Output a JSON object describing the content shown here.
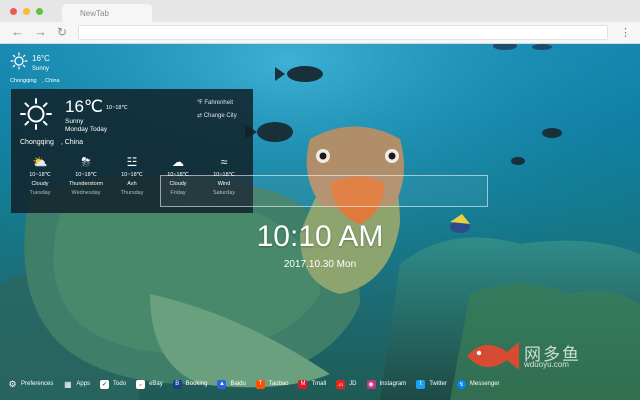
{
  "browser": {
    "tab_title": "NewTab",
    "back_icon": "back-arrow-icon",
    "forward_icon": "forward-arrow-icon",
    "reload_icon": "reload-icon",
    "menu_icon": "menu-icon",
    "url_value": ""
  },
  "weather_mini": {
    "temp": "16°C",
    "condition": "Sunny",
    "location": "Chongqing　, China"
  },
  "weather_panel": {
    "temp": "16℃",
    "range": "10~18℃",
    "condition": "Sunny",
    "day": "Monday Today",
    "location": "Chongqing　, China",
    "fahrenheit_label": "Fahrenheit",
    "change_city_label": "Change City",
    "forecast": [
      {
        "icon": "cloud-sun-icon",
        "range": "10~18℃",
        "cond": "Cloudy",
        "day": "Tuesday"
      },
      {
        "icon": "thunderstorm-icon",
        "range": "10~18℃",
        "cond": "Thunderstorm",
        "day": "Wednesday"
      },
      {
        "icon": "ash-icon",
        "range": "10~18℃",
        "cond": "Ash",
        "day": "Thursday"
      },
      {
        "icon": "cloud-icon",
        "range": "10~18℃",
        "cond": "Cloudy",
        "day": "Friday"
      },
      {
        "icon": "wind-icon",
        "range": "10~18℃",
        "cond": "Wind",
        "day": "Saturday"
      }
    ]
  },
  "search": {
    "placeholder": ""
  },
  "clock": {
    "time": "10:10 AM",
    "date": "2017.10.30 Mon"
  },
  "watermark": {
    "text": "网多鱼",
    "url": "wduoyu.com"
  },
  "bottom_bar": [
    {
      "label": "Preferences",
      "icon": "gear-icon",
      "color": "#111111"
    },
    {
      "label": "Apps",
      "icon": "grid-icon",
      "color": "#111111"
    },
    {
      "label": "Todo",
      "icon": "checkbox-icon",
      "color": "#ffffff"
    },
    {
      "label": "eBay",
      "icon": "ebay-icon",
      "color": "#ffffff"
    },
    {
      "label": "Booking",
      "icon": "booking-icon",
      "color": "#1d3f8a"
    },
    {
      "label": "Baidu",
      "icon": "baidu-icon",
      "color": "#2a64e0"
    },
    {
      "label": "Taobao",
      "icon": "taobao-icon",
      "color": "#ff5000"
    },
    {
      "label": "Tmall",
      "icon": "tmall-icon",
      "color": "#e0162b"
    },
    {
      "label": "JD",
      "icon": "jd-icon",
      "color": "#e1251b"
    },
    {
      "label": "Instagram",
      "icon": "instagram-icon",
      "color": "#c13584"
    },
    {
      "label": "Twitter",
      "icon": "twitter-icon",
      "color": "#1da1f2"
    },
    {
      "label": "Messenger",
      "icon": "messenger-icon",
      "color": "#0084ff"
    }
  ]
}
